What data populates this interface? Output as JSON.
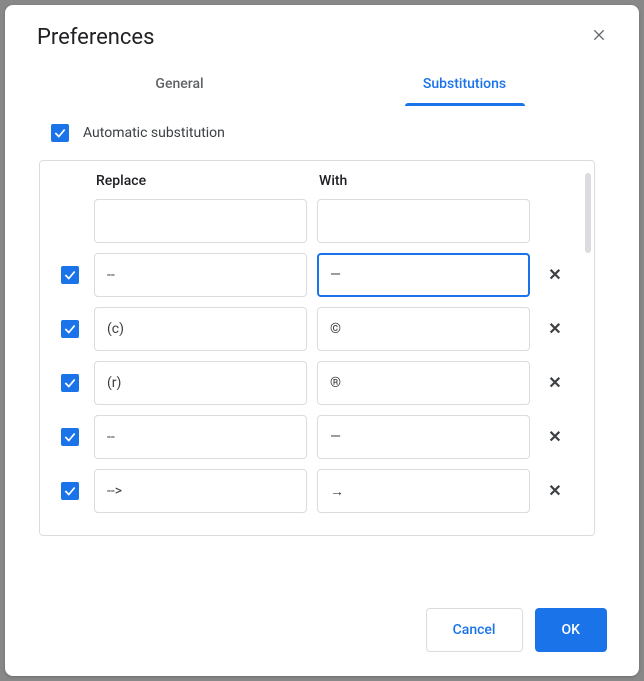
{
  "dialog": {
    "title": "Preferences"
  },
  "tabs": {
    "general": "General",
    "substitutions": "Substitutions"
  },
  "auto_sub": {
    "label": "Automatic substitution",
    "checked": true
  },
  "columns": {
    "replace": "Replace",
    "with": "With"
  },
  "new_row": {
    "replace": "",
    "with": ""
  },
  "rows": [
    {
      "checked": true,
      "replace": "--",
      "with": "—",
      "with_focused": true
    },
    {
      "checked": true,
      "replace": "(c)",
      "with": "©",
      "with_focused": false
    },
    {
      "checked": true,
      "replace": "(r)",
      "with": "®",
      "with_focused": false
    },
    {
      "checked": true,
      "replace": "--",
      "with": "—",
      "with_focused": false
    },
    {
      "checked": true,
      "replace": "-->",
      "with": "→",
      "with_focused": false
    }
  ],
  "footer": {
    "cancel": "Cancel",
    "ok": "OK"
  }
}
